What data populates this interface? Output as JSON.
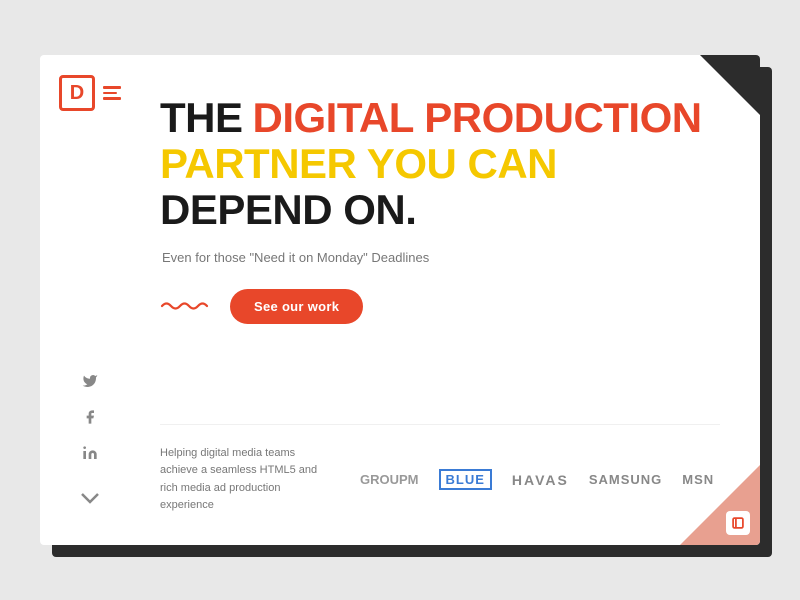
{
  "logo": {
    "symbol": "D",
    "brand_name": "D"
  },
  "navigation": {
    "menu_label": "menu"
  },
  "hero": {
    "title_part1": "THE",
    "title_part2": "DIGITAL PRODUCTION",
    "title_part3": "PARTNER YOU CAN",
    "title_part4": "DEPEND ON.",
    "subtitle": "Even for those \"Need it on Monday\" Deadlines",
    "cta_label": "See our work"
  },
  "social": {
    "twitter_label": "Twitter",
    "facebook_label": "Facebook",
    "linkedin_label": "LinkedIn"
  },
  "bottom": {
    "description": "Helping digital media teams achieve a seamless HTML5 and rich media ad production experience"
  },
  "partner_logos": [
    {
      "name": "groupm",
      "label": "groupm"
    },
    {
      "name": "blue",
      "label": "Blue"
    },
    {
      "name": "havas",
      "label": "HAVAS"
    },
    {
      "name": "samsung",
      "label": "SAMSUNG"
    },
    {
      "name": "msn",
      "label": "msn"
    }
  ],
  "scroll": {
    "label": "scroll down"
  },
  "colors": {
    "orange": "#e8472a",
    "yellow": "#f5c800",
    "dark": "#2c2c2c",
    "light_orange": "#e8a090"
  }
}
